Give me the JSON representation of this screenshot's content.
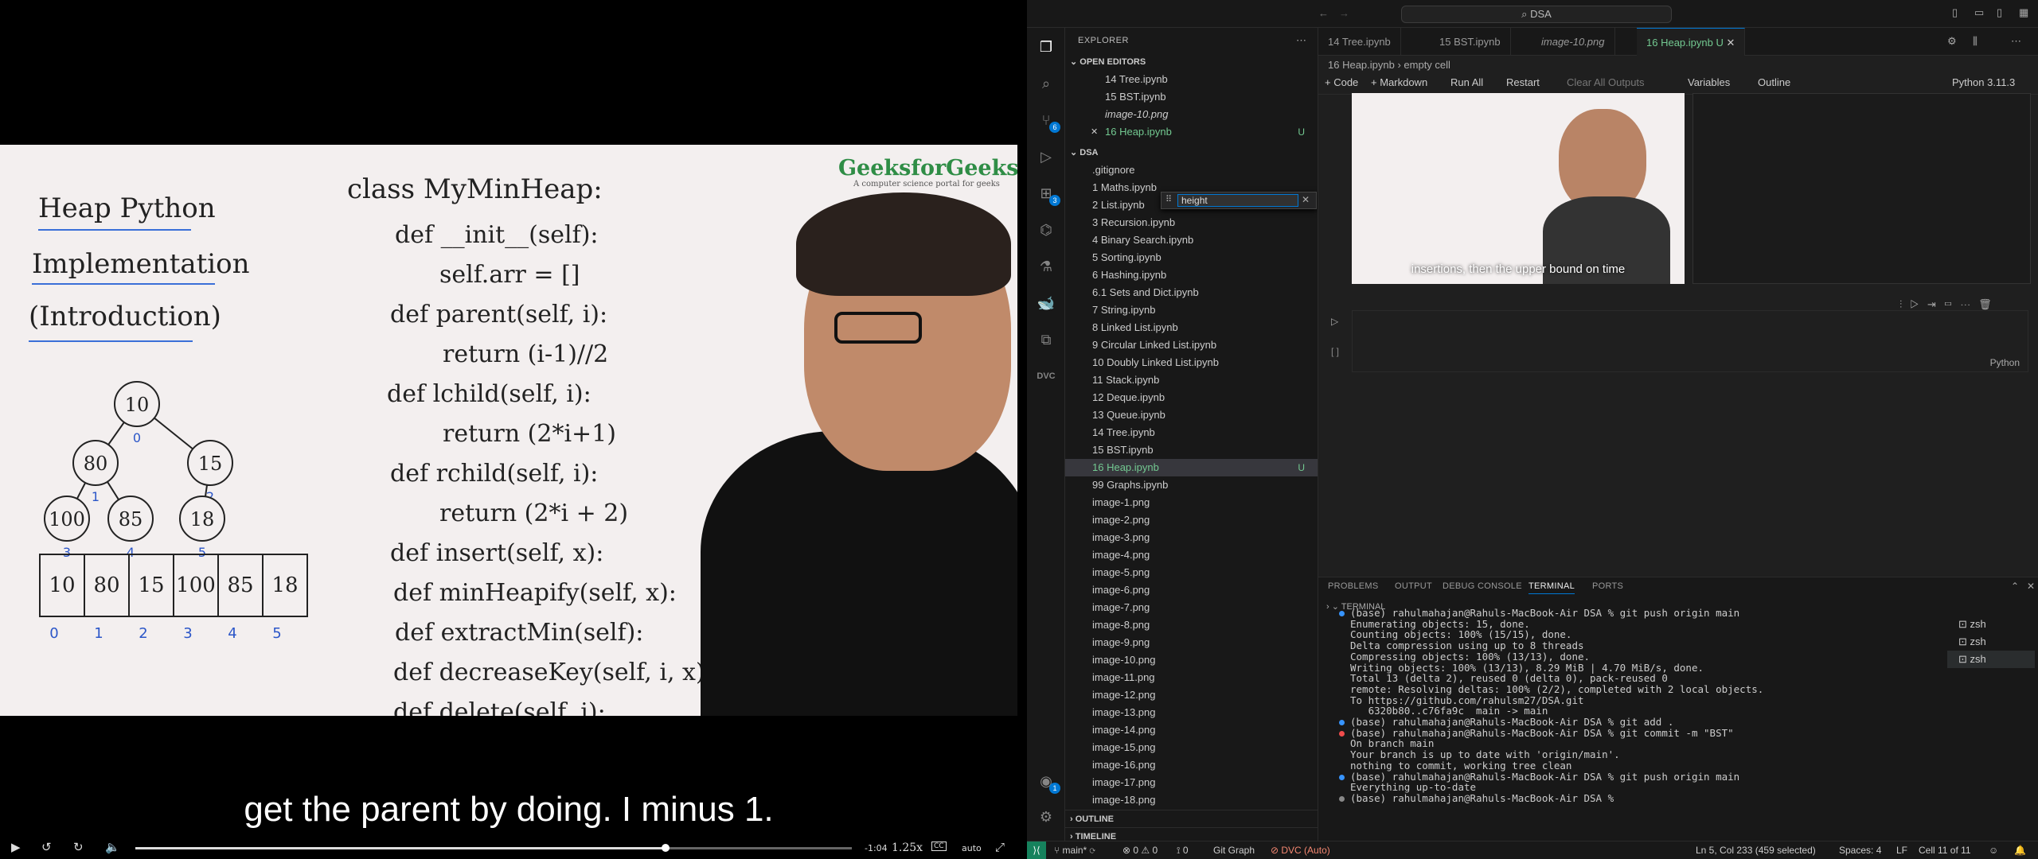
{
  "video": {
    "brand": "GeeksforGeeks",
    "brand_sub": "A computer science portal for geeks",
    "board_title": [
      "Heap Python",
      "Implementation",
      "(Introduction)"
    ],
    "class_line": "class MyMinHeap:",
    "code_lines": [
      "def __init__(self):",
      "self.arr = []",
      "def parent(self, i):",
      "return (i-1)//2",
      "def lchild(self, i):",
      "return (2*i+1)",
      "def rchild(self, i):",
      "return (2*i + 2)",
      "def insert(self, x):",
      "def minHeapify(self, x):",
      "def extractMin(self):",
      "def decreaseKey(self, i, x):",
      "def delete(self, i):"
    ],
    "tree_nodes": [
      "10",
      "80",
      "15",
      "100",
      "85",
      "18"
    ],
    "array_cells": [
      "10",
      "80",
      "15",
      "100",
      "85",
      "18"
    ],
    "array_indices": [
      "0",
      "1",
      "2",
      "3",
      "4",
      "5"
    ],
    "subtitle": "get the parent by doing. I minus 1.",
    "time_remaining": "-1:04",
    "speed": "1.25x",
    "quality": "auto",
    "cc": "CC",
    "progress": 0.74
  },
  "vscode": {
    "command_center": "DSA",
    "explorer_title": "EXPLORER",
    "open_editors_title": "OPEN EDITORS",
    "open_editors": [
      {
        "label": "14 Tree.ipynb",
        "badge": ""
      },
      {
        "label": "15 BST.ipynb",
        "badge": ""
      },
      {
        "label": "image-10.png",
        "badge": ""
      },
      {
        "label": "16 Heap.ipynb",
        "badge": "U"
      }
    ],
    "folder_title": "DSA",
    "files": [
      {
        "label": ".gitignore",
        "badge": ""
      },
      {
        "label": "1 Maths.ipynb",
        "badge": ""
      },
      {
        "label": "2 List.ipynb",
        "badge": ""
      },
      {
        "label": "3 Recursion.ipynb",
        "badge": ""
      },
      {
        "label": "4 Binary Search.ipynb",
        "badge": ""
      },
      {
        "label": "5 Sorting.ipynb",
        "badge": ""
      },
      {
        "label": "6 Hashing.ipynb",
        "badge": ""
      },
      {
        "label": "6.1 Sets and Dict.ipynb",
        "badge": ""
      },
      {
        "label": "7 String.ipynb",
        "badge": ""
      },
      {
        "label": "8 Linked List.ipynb",
        "badge": ""
      },
      {
        "label": "9 Circular Linked List.ipynb",
        "badge": ""
      },
      {
        "label": "10 Doubly Linked List.ipynb",
        "badge": ""
      },
      {
        "label": "11 Stack.ipynb",
        "badge": ""
      },
      {
        "label": "12 Deque.ipynb",
        "badge": ""
      },
      {
        "label": "13 Queue.ipynb",
        "badge": ""
      },
      {
        "label": "14 Tree.ipynb",
        "badge": ""
      },
      {
        "label": "15 BST.ipynb",
        "badge": ""
      },
      {
        "label": "16 Heap.ipynb",
        "badge": "U"
      },
      {
        "label": "99 Graphs.ipynb",
        "badge": ""
      },
      {
        "label": "image-1.png",
        "badge": ""
      },
      {
        "label": "image-2.png",
        "badge": ""
      },
      {
        "label": "image-3.png",
        "badge": ""
      },
      {
        "label": "image-4.png",
        "badge": ""
      },
      {
        "label": "image-5.png",
        "badge": ""
      },
      {
        "label": "image-6.png",
        "badge": ""
      },
      {
        "label": "image-7.png",
        "badge": ""
      },
      {
        "label": "image-8.png",
        "badge": ""
      },
      {
        "label": "image-9.png",
        "badge": ""
      },
      {
        "label": "image-10.png",
        "badge": ""
      },
      {
        "label": "image-11.png",
        "badge": ""
      },
      {
        "label": "image-12.png",
        "badge": ""
      },
      {
        "label": "image-13.png",
        "badge": ""
      },
      {
        "label": "image-14.png",
        "badge": ""
      },
      {
        "label": "image-15.png",
        "badge": ""
      },
      {
        "label": "image-16.png",
        "badge": ""
      },
      {
        "label": "image-17.png",
        "badge": ""
      },
      {
        "label": "image-18.png",
        "badge": ""
      }
    ],
    "outline_title": "OUTLINE",
    "timeline_title": "TIMELINE",
    "find_value": "height",
    "tabs": [
      "14 Tree.ipynb",
      "15 BST.ipynb",
      "image-10.png",
      "16 Heap.ipynb U"
    ],
    "breadcrumb": [
      "16 Heap.ipynb",
      "empty cell"
    ],
    "nb_toolbar": [
      "+ Code",
      "+ Markdown",
      "Run All",
      "Restart",
      "Clear All Outputs",
      "Variables",
      "Outline"
    ],
    "kernel": "Python 3.11.3",
    "thumb_caption": "insertions, then the upper bound on time",
    "cell_lang": "Python",
    "panel_tabs": [
      "PROBLEMS",
      "OUTPUT",
      "DEBUG CONSOLE",
      "TERMINAL",
      "PORTS"
    ],
    "terminal_title": "TERMINAL",
    "terminal_lines": [
      "(base) rahulmahajan@Rahuls-MacBook-Air DSA % git push origin main",
      "Enumerating objects: 15, done.",
      "Counting objects: 100% (15/15), done.",
      "Delta compression using up to 8 threads",
      "Compressing objects: 100% (13/13), done.",
      "Writing objects: 100% (13/13), 8.29 MiB | 4.70 MiB/s, done.",
      "Total 13 (delta 2), reused 0 (delta 0), pack-reused 0",
      "remote: Resolving deltas: 100% (2/2), completed with 2 local objects.",
      "To https://github.com/rahulsm27/DSA.git",
      "   6320b80..c76fa9c  main -> main",
      "(base) rahulmahajan@Rahuls-MacBook-Air DSA % git add .",
      "(base) rahulmahajan@Rahuls-MacBook-Air DSA % git commit -m \"BST\"",
      "On branch main",
      "Your branch is up to date with 'origin/main'.",
      "",
      "nothing to commit, working tree clean",
      "(base) rahulmahajan@Rahuls-MacBook-Air DSA % git push origin main",
      "Everything up-to-date",
      "(base) rahulmahajan@Rahuls-MacBook-Air DSA % "
    ],
    "shells": [
      "zsh",
      "zsh",
      "zsh"
    ],
    "status": {
      "branch": "main*",
      "errors": "0",
      "warnings": "0",
      "ports": "0",
      "git_graph": "Git Graph",
      "dvc": "DVC (Auto)",
      "position": "Ln 5, Col 233 (459 selected)",
      "spaces": "Spaces: 4",
      "eol": "LF",
      "cell": "Cell 11 of 11"
    },
    "colors": {
      "accent": "#0078d4",
      "untracked": "#73c991",
      "remote": "#16825d"
    }
  }
}
